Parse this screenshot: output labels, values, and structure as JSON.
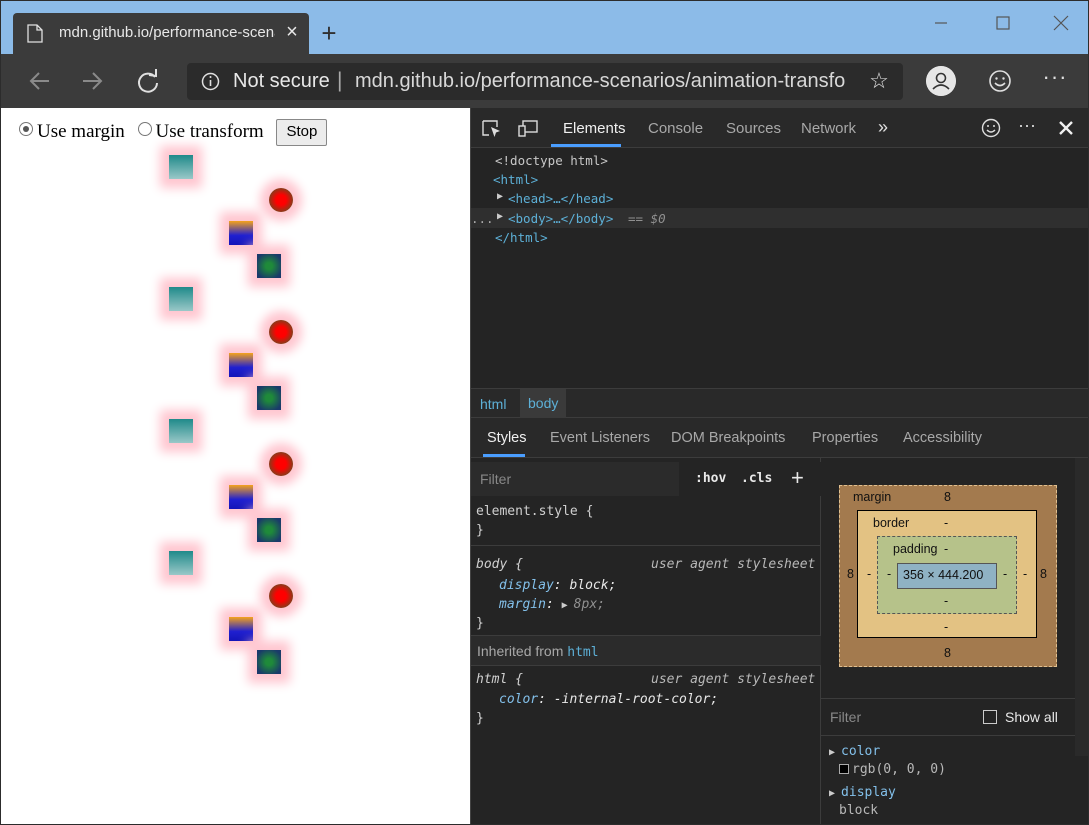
{
  "browser": {
    "tab_title": "mdn.github.io/performance-scenarios/animation-transform",
    "tab_close": "×",
    "new_tab": "+",
    "address": {
      "security_label": "Not secure",
      "separator": "|",
      "url": "mdn.github.io/performance-scenarios/animation-transform/index.html"
    }
  },
  "page": {
    "radio_margin_label": "Use margin",
    "radio_transform_label": "Use transform",
    "selected_mode": "Use margin",
    "stop_button_label": "Stop"
  },
  "devtools": {
    "tabs": [
      "Elements",
      "Console",
      "Sources",
      "Network"
    ],
    "active_tab": "Elements",
    "more_tabs": "»",
    "dom": {
      "doctype": "<!doctype html>",
      "html_open": "<html>",
      "head": "<head>…</head>",
      "body": "<body>…</body>",
      "body_marker": "== $0",
      "html_close": "</html>",
      "ellipsis": "..."
    },
    "breadcrumbs": [
      "html",
      "body"
    ],
    "sub_tabs": [
      "Styles",
      "Event Listeners",
      "DOM Breakpoints",
      "Properties",
      "Accessibility"
    ],
    "styles": {
      "filter_placeholder": "Filter",
      "hov": ":hov",
      "cls": ".cls",
      "add": "+",
      "element_style_selector": "element.style {",
      "close_brace": "}",
      "body_selector": "body {",
      "body_source": "user agent stylesheet",
      "body_props": [
        {
          "name": "display",
          "value": "block;"
        },
        {
          "name": "margin",
          "value": "8px;"
        }
      ],
      "inherited_prefix": "Inherited from",
      "inherited_from": "html",
      "html_selector": "html {",
      "html_source": "user agent stylesheet",
      "html_props": [
        {
          "name": "color",
          "value": "-internal-root-color;"
        }
      ]
    },
    "box_model": {
      "margin_label": "margin",
      "margin_top": "8",
      "margin_bottom": "8",
      "margin_left": "8",
      "margin_right": "8",
      "border_label": "border",
      "border_top": "-",
      "border_bottom": "-",
      "border_left": "-",
      "border_right": "-",
      "padding_label": "padding",
      "padding_top": "-",
      "padding_bottom": "-",
      "padding_left": "-",
      "padding_right": "-",
      "content": "356 × 444.200"
    },
    "computed": {
      "filter_placeholder": "Filter",
      "show_all_label": "Show all",
      "props": [
        {
          "name": "color",
          "value": "rgb(0, 0, 0)"
        },
        {
          "name": "display",
          "value": "block"
        }
      ]
    }
  },
  "colors": {
    "titlebar": "#8cbbe8",
    "toolbar": "#3b3b3b",
    "devtools_bg": "#242424",
    "accent": "#4a9eff",
    "tag_blue": "#5db0d7"
  }
}
